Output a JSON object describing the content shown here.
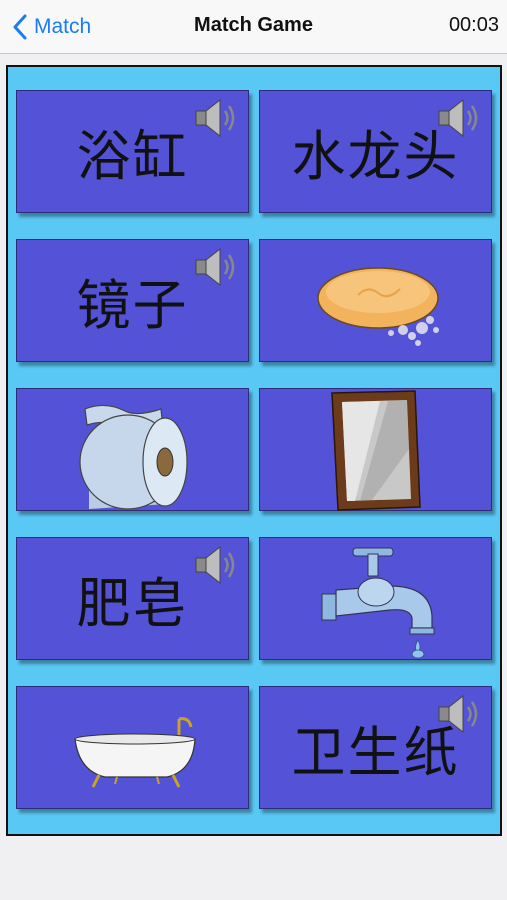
{
  "nav": {
    "back_label": "Match",
    "title": "Match Game",
    "timer": "00:03"
  },
  "cards": [
    {
      "kind": "word",
      "text": "浴缸",
      "icon": "speaker-icon"
    },
    {
      "kind": "word",
      "text": "水龙头",
      "icon": "speaker-icon"
    },
    {
      "kind": "word",
      "text": "镜子",
      "icon": "speaker-icon"
    },
    {
      "kind": "image",
      "icon": "soap-icon"
    },
    {
      "kind": "image",
      "icon": "toilet-paper-icon"
    },
    {
      "kind": "image",
      "icon": "mirror-icon"
    },
    {
      "kind": "word",
      "text": "肥皂",
      "icon": "speaker-icon"
    },
    {
      "kind": "image",
      "icon": "faucet-icon"
    },
    {
      "kind": "image",
      "icon": "bathtub-icon"
    },
    {
      "kind": "word",
      "text": "卫生纸",
      "icon": "speaker-icon"
    }
  ],
  "colors": {
    "board": "#5ac8f5",
    "card": "#5452d6",
    "accent": "#1a7cf5"
  }
}
